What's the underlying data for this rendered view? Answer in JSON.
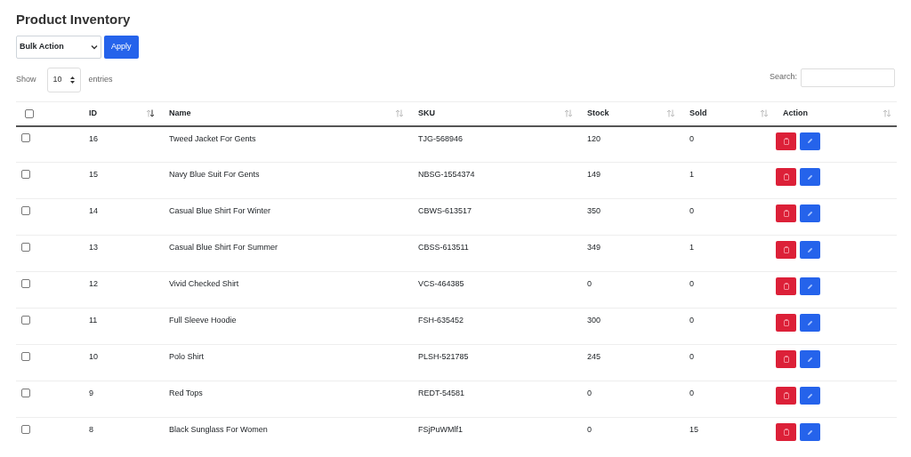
{
  "title": "Product Inventory",
  "bulk_action": {
    "value": "Bulk Action",
    "button": "Apply"
  },
  "length": {
    "show": "Show",
    "value": "10",
    "entries": "entries"
  },
  "search": {
    "label": "Search:"
  },
  "table": {
    "select_all_checked": false,
    "columns": [
      {
        "label": "ID",
        "sorted": true
      },
      {
        "label": "Name",
        "sorted": false
      },
      {
        "label": "SKU",
        "sorted": false
      },
      {
        "label": "Stock",
        "sorted": false
      },
      {
        "label": "Sold",
        "sorted": false
      },
      {
        "label": "Action",
        "sorted": false
      }
    ],
    "rows": [
      {
        "checked": false,
        "id": "16",
        "name": "Tweed Jacket For Gents",
        "sku": "TJG-568946",
        "stock": "120",
        "sold": "0"
      },
      {
        "checked": false,
        "id": "15",
        "name": "Navy Blue Suit For Gents",
        "sku": "NBSG-1554374",
        "stock": "149",
        "sold": "1"
      },
      {
        "checked": false,
        "id": "14",
        "name": "Casual Blue Shirt For Winter",
        "sku": "CBWS-613517",
        "stock": "350",
        "sold": "0"
      },
      {
        "checked": false,
        "id": "13",
        "name": "Casual Blue Shirt For Summer",
        "sku": "CBSS-613511",
        "stock": "349",
        "sold": "1"
      },
      {
        "checked": false,
        "id": "12",
        "name": "Vivid Checked Shirt",
        "sku": "VCS-464385",
        "stock": "0",
        "sold": "0"
      },
      {
        "checked": false,
        "id": "11",
        "name": "Full Sleeve Hoodie",
        "sku": "FSH-635452",
        "stock": "300",
        "sold": "0"
      },
      {
        "checked": false,
        "id": "10",
        "name": "Polo Shirt",
        "sku": "PLSH-521785",
        "stock": "245",
        "sold": "0"
      },
      {
        "checked": false,
        "id": "9",
        "name": "Red Tops",
        "sku": "REDT-54581",
        "stock": "0",
        "sold": "0"
      },
      {
        "checked": false,
        "id": "8",
        "name": "Black Sunglass For Women",
        "sku": "FSjPuWMlf1",
        "stock": "0",
        "sold": "15"
      }
    ]
  }
}
